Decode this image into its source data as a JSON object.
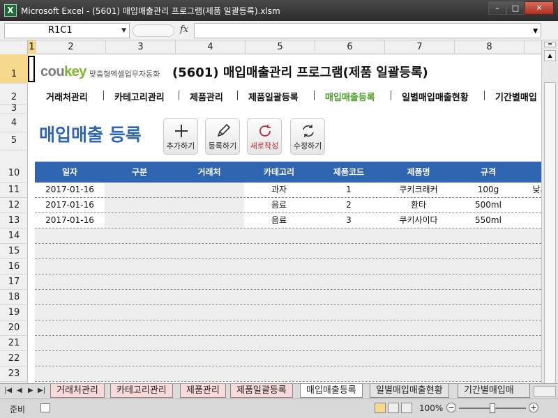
{
  "window": {
    "title": "Microsoft Excel - (5601) 매입매출관리 프로그램(제품 일괄등록).xlsm",
    "app_icon": "X",
    "minimize": "–",
    "restore": "□",
    "close": "✕"
  },
  "formula_bar": {
    "name_box": "R1C1",
    "fx": "fx",
    "formula": ""
  },
  "columns": [
    "1",
    "2",
    "3",
    "4",
    "5",
    "6",
    "7",
    "8"
  ],
  "rows": [
    "1",
    "2",
    "3",
    "4",
    "5",
    "10",
    "11",
    "12",
    "13",
    "14",
    "15",
    "16",
    "17",
    "18",
    "19",
    "20",
    "21",
    "22",
    "23"
  ],
  "header": {
    "logo_cou": "cou",
    "logo_key": "key",
    "logo_sub": "맞춤형엑셀업무자동화",
    "title": "(5601) 매입매출관리 프로그램(제품 일괄등록)"
  },
  "nav": {
    "items": [
      "거래처관리",
      "카테고리관리",
      "제품관리",
      "제품일괄등록",
      "매입매출등록",
      "일별매입매출현황",
      "기간별매입"
    ],
    "active_index": 4
  },
  "page": {
    "title": "매입매출 등록"
  },
  "toolbar": {
    "add": "추가하기",
    "register": "등록하기",
    "new": "새로작성",
    "edit": "수정하기"
  },
  "table": {
    "headers": [
      "일자",
      "구분",
      "거래처",
      "카테고리",
      "제품코드",
      "제품명",
      "규격",
      ""
    ],
    "rows": [
      [
        "2017-01-16",
        "",
        "",
        "과자",
        "1",
        "쿠키크래커",
        "100g",
        "낮세가"
      ],
      [
        "2017-01-16",
        "",
        "",
        "음료",
        "2",
        "환타",
        "500ml",
        ""
      ],
      [
        "2017-01-16",
        "",
        "",
        "음료",
        "3",
        "쿠키사이다",
        "550ml",
        ""
      ]
    ]
  },
  "sheet_tabs": {
    "tabs": [
      "거래처관리",
      "카테고리관리",
      "제품관리",
      "제품일괄등록",
      "매입매출등록",
      "일별매입매출현황",
      "기간별매입매"
    ],
    "active_index": 4
  },
  "status": {
    "ready": "준비",
    "zoom": "100%"
  },
  "colors": {
    "accent_blue": "#2f64b0",
    "active_green": "#4da02b",
    "logo_green": "#79b829",
    "new_red": "#c0282b"
  }
}
